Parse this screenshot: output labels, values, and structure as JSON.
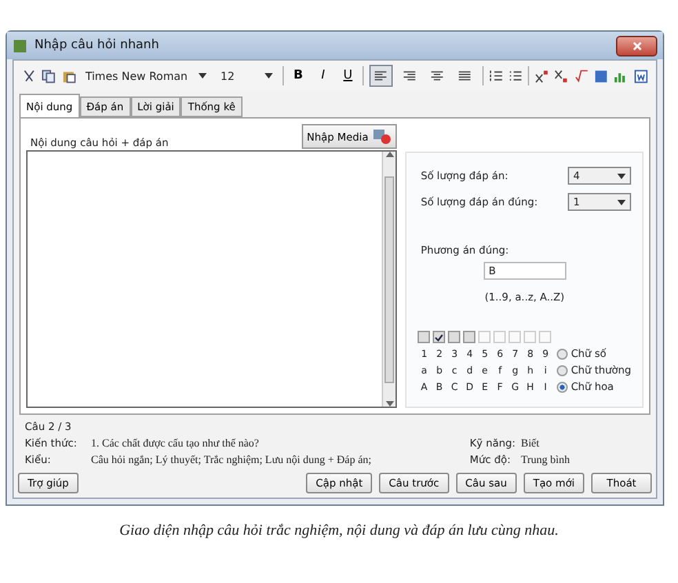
{
  "window": {
    "title": "Nhập câu hỏi nhanh"
  },
  "toolbar": {
    "font": "Times New Roman",
    "size": "12",
    "format_buttons": [
      {
        "label": "B",
        "kind": "bold"
      },
      {
        "label": "I",
        "kind": "italic"
      },
      {
        "label": "U",
        "kind": "underline"
      }
    ],
    "align_buttons": [
      {
        "kind": "left",
        "selected": true
      },
      {
        "kind": "right",
        "selected": false
      },
      {
        "kind": "center",
        "selected": false
      },
      {
        "kind": "justify",
        "selected": false
      }
    ]
  },
  "tabs": [
    {
      "label": "Nội dung",
      "selected": true
    },
    {
      "label": "Đáp án",
      "selected": false
    },
    {
      "label": "Lời giải",
      "selected": false
    },
    {
      "label": "Thống kê",
      "selected": false
    }
  ],
  "editor": {
    "label": "Nội dung câu hỏi + đáp án",
    "media_button": "Nhập Media"
  },
  "answers": {
    "count_label": "Số lượng đáp án:",
    "count": "4",
    "correct_count_label": "Số lượng đáp án đúng:",
    "correct_count": "1",
    "correct_label": "Phương án đúng:",
    "correct_value": "B",
    "hint": "(1..9, a..z, A..Z)",
    "checkboxes": [
      {
        "checked": false,
        "disabled": false
      },
      {
        "checked": true,
        "disabled": false
      },
      {
        "checked": false,
        "disabled": false
      },
      {
        "checked": false,
        "disabled": false
      },
      {
        "checked": false,
        "disabled": true
      },
      {
        "checked": false,
        "disabled": true
      },
      {
        "checked": false,
        "disabled": true
      },
      {
        "checked": false,
        "disabled": true
      },
      {
        "checked": false,
        "disabled": true
      }
    ],
    "label_rows": [
      {
        "labels": [
          "1",
          "2",
          "3",
          "4",
          "5",
          "6",
          "7",
          "8",
          "9"
        ],
        "option": "Chữ số",
        "selected": false
      },
      {
        "labels": [
          "a",
          "b",
          "c",
          "d",
          "e",
          "f",
          "g",
          "h",
          "i"
        ],
        "option": "Chữ thường",
        "selected": false
      },
      {
        "labels": [
          "A",
          "B",
          "C",
          "D",
          "E",
          "F",
          "G",
          "H",
          "I"
        ],
        "option": "Chữ hoa",
        "selected": true
      }
    ]
  },
  "info": {
    "position": "Câu 2 / 3",
    "knowledge_label": "Kiến thức:",
    "knowledge": "1. Các chất được cấu tạo như thế nào?",
    "skill_label": "Kỹ năng:",
    "skill": "Biết",
    "type_label": "Kiểu:",
    "type": "Câu hỏi ngắn; Lý thuyết; Trắc nghiệm; Lưu nội dung + Đáp án;",
    "level_label": "Mức độ:",
    "level_value": "Trung bình"
  },
  "buttons": {
    "help": "Trợ giúp",
    "actions": [
      "Cập nhật",
      "Câu trước",
      "Câu sau",
      "Tạo mới",
      "Thoát"
    ]
  },
  "caption": "Giao diện nhập câu hỏi trắc nghiệm, nội dung và đáp án lưu cùng nhau."
}
